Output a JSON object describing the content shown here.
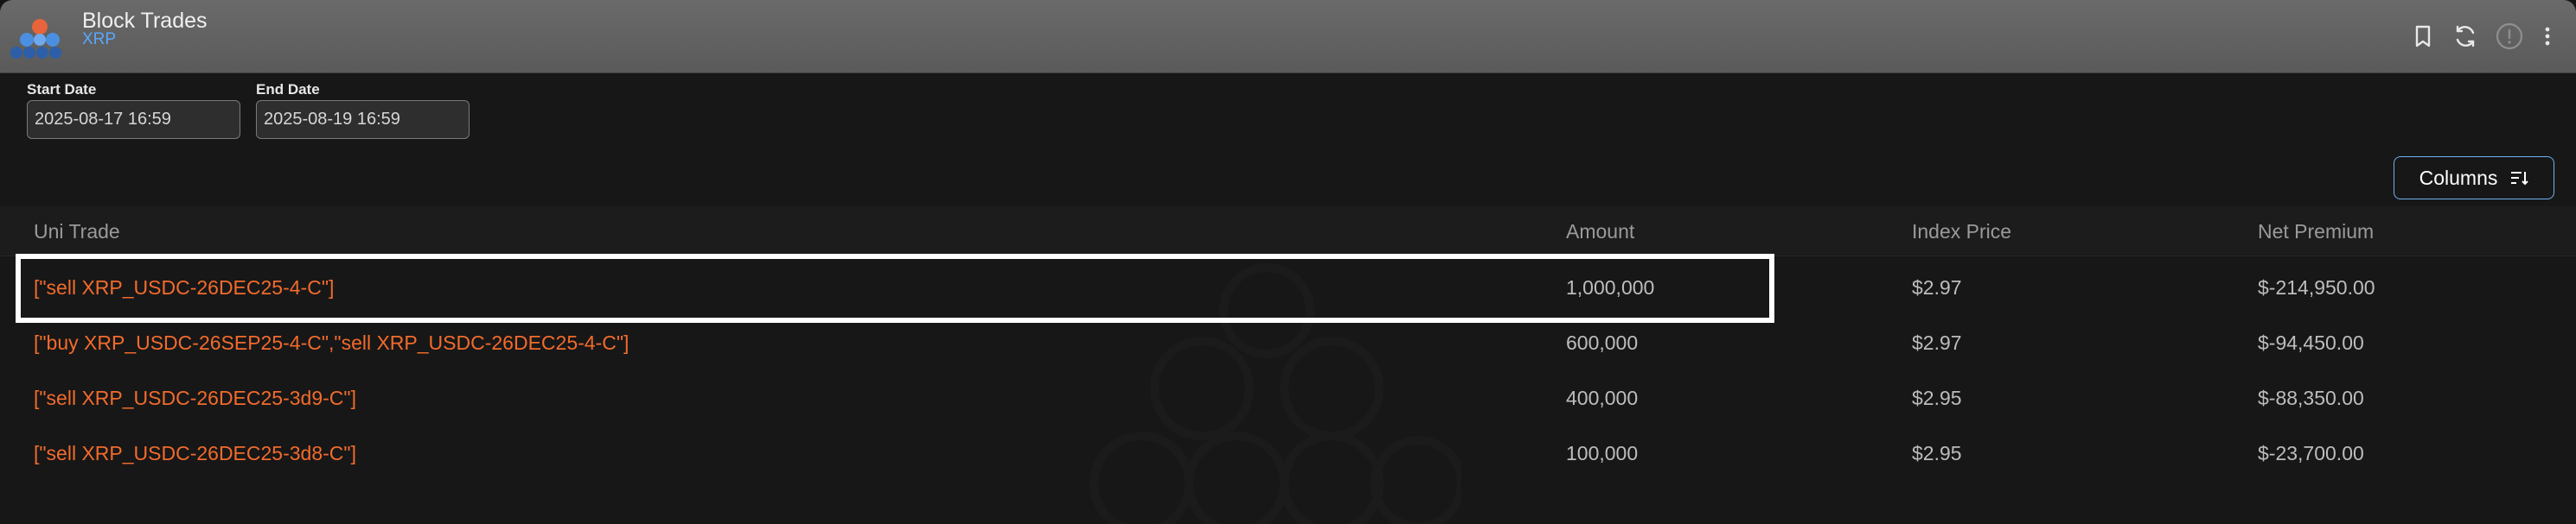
{
  "header": {
    "title": "Block Trades",
    "subtitle": "XRP"
  },
  "toolbar": {
    "icons": [
      "bookmark-icon",
      "refresh-icon",
      "info-icon",
      "more-vertical-icon"
    ]
  },
  "filters": {
    "start_label": "Start Date",
    "start_value": "2025-08-17 16:59",
    "end_label": "End Date",
    "end_value": "2025-08-19 16:59"
  },
  "columns_button": {
    "label": "Columns"
  },
  "table": {
    "headers": {
      "trade": "Uni Trade",
      "amount": "Amount",
      "index_price": "Index Price",
      "net_premium": "Net Premium"
    },
    "rows": [
      {
        "trade": "[\"sell XRP_USDC-26DEC25-4-C\"]",
        "amount": "1,000,000",
        "index_price": "$2.97",
        "net_premium": "$-214,950.00"
      },
      {
        "trade": "[\"buy XRP_USDC-26SEP25-4-C\",\"sell XRP_USDC-26DEC25-4-C\"]",
        "amount": "600,000",
        "index_price": "$2.97",
        "net_premium": "$-94,450.00"
      },
      {
        "trade": "[\"sell XRP_USDC-26DEC25-3d9-C\"]",
        "amount": "400,000",
        "index_price": "$2.95",
        "net_premium": "$-88,350.00"
      },
      {
        "trade": "[\"sell XRP_USDC-26DEC25-3d8-C\"]",
        "amount": "100,000",
        "index_price": "$2.95",
        "net_premium": "$-23,700.00"
      }
    ]
  },
  "colors": {
    "accent_blue": "#5aa7ff",
    "trade_orange": "#f26b2c",
    "background": "#171717"
  }
}
